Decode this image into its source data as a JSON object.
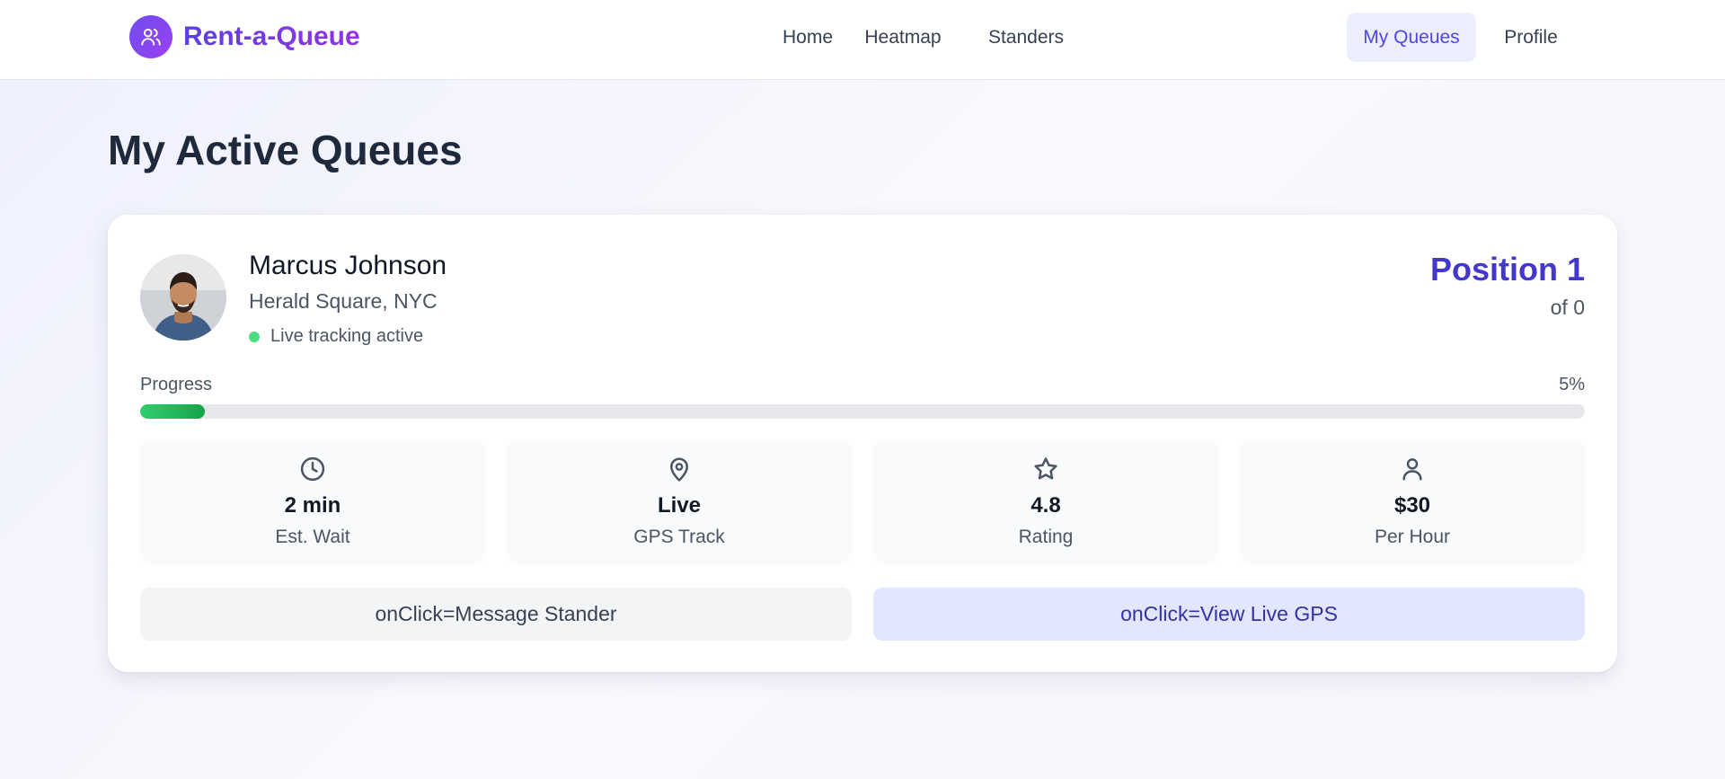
{
  "app": {
    "brand_name": "Rent-a-Queue",
    "brand_icon": "users-icon"
  },
  "nav": {
    "items": [
      {
        "label": "Home",
        "active": false
      },
      {
        "label": "Heatmap",
        "active": false
      },
      {
        "label": "Standers",
        "active": false
      },
      {
        "label": "My Queues",
        "active": true
      },
      {
        "label": "Profile",
        "active": false
      }
    ]
  },
  "page": {
    "title": "My Active Queues"
  },
  "queue": {
    "stander_name": "Marcus Johnson",
    "location": "Herald Square, NYC",
    "tracking_status": "Live tracking active",
    "position_label": "Position 1",
    "position_of": "of 0",
    "progress_label": "Progress",
    "progress_value": "5%",
    "progress_fraction": 0.045,
    "stats": [
      {
        "icon": "clock-icon",
        "value": "2 min",
        "label": "Est. Wait"
      },
      {
        "icon": "map-pin-icon",
        "value": "Live",
        "label": "GPS Track"
      },
      {
        "icon": "star-icon",
        "value": "4.8",
        "label": "Rating"
      },
      {
        "icon": "user-icon",
        "value": "$30",
        "label": "Per Hour"
      }
    ],
    "actions": {
      "message_label": "onClick=Message Stander",
      "gps_label": "onClick=View Live GPS"
    }
  },
  "colors": {
    "accent": "#4f46e5",
    "brand_gradient_start": "#5b3fe0",
    "brand_gradient_end": "#9334e6",
    "progress_fill": "#22c55e",
    "live_dot": "#4ade80"
  }
}
